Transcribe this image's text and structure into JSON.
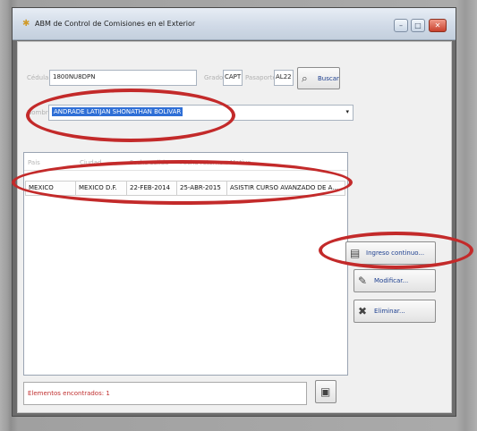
{
  "window": {
    "title": "ABM de Control de Comisiones en el Exterior",
    "min_icon": "minimize-icon",
    "max_icon": "maximize-icon",
    "close_icon": "close-icon"
  },
  "form": {
    "cedula_label": "Cédula",
    "cedula_value": "1800NU8DPN",
    "grado_label": "Grado",
    "grado_value": "CAPT",
    "pasaporte_label": "Pasaporte",
    "pasaporte_value": "AL22",
    "buscar_label": "Buscar",
    "nombre_label": "Nombre",
    "nombre_value": "ANDRADE LATIJAN SHONATHAN BOLIVAR"
  },
  "table": {
    "columns": [
      "Pais",
      "Ciudad",
      "Fecha salida",
      "Fecha retorno",
      "Motivo"
    ],
    "rows": [
      [
        "MEXICO",
        "MEXICO D.F.",
        "22-FEB-2014",
        "25-ABR-2015",
        "ASISTIR CURSO AVANZADO DE A..."
      ]
    ]
  },
  "actions": {
    "ingreso_label": "Ingreso continuo...",
    "modificar_label": "Modificar...",
    "eliminar_label": "Eliminar..."
  },
  "status": {
    "text": "Elementos encontrados: 1"
  },
  "colors": {
    "highlight_ellipse": "#c32a2a",
    "selection": "#2f6fd6",
    "status_text": "#c03030"
  }
}
